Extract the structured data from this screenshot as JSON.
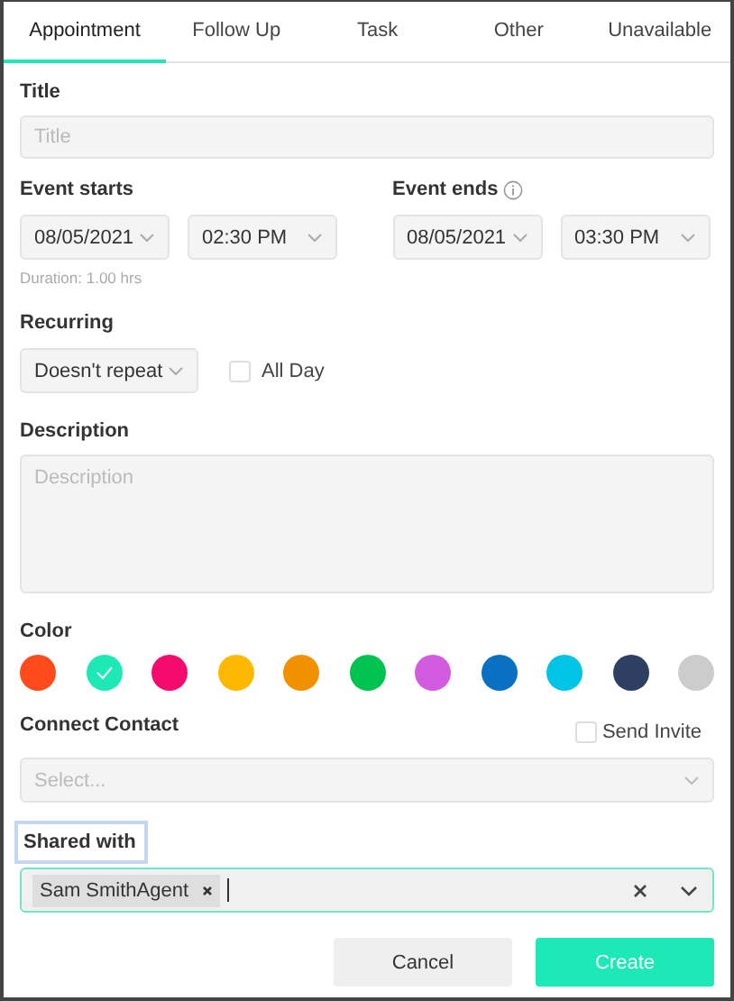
{
  "tabs": [
    {
      "label": "Appointment",
      "selected": true
    },
    {
      "label": "Follow Up",
      "selected": false
    },
    {
      "label": "Task",
      "selected": false
    },
    {
      "label": "Other",
      "selected": false
    },
    {
      "label": "Unavailable",
      "selected": false
    }
  ],
  "title": {
    "label": "Title",
    "placeholder": "Title"
  },
  "event_starts": {
    "label": "Event starts",
    "date": "08/05/2021",
    "time": "02:30 PM",
    "duration": "Duration: 1.00 hrs"
  },
  "event_ends": {
    "label": "Event ends",
    "date": "08/05/2021",
    "time": "03:30 PM"
  },
  "recurring": {
    "label": "Recurring",
    "value": "Doesn't repeat",
    "all_day": {
      "label": "All Day",
      "checked": false
    }
  },
  "description": {
    "label": "Description",
    "placeholder": "Description"
  },
  "color": {
    "label": "Color",
    "swatches": [
      {
        "color": "#ff4a1c",
        "selected": false
      },
      {
        "color": "#1de9b6",
        "selected": true
      },
      {
        "color": "#f50a6e",
        "selected": false
      },
      {
        "color": "#ffb800",
        "selected": false
      },
      {
        "color": "#f29100",
        "selected": false
      },
      {
        "color": "#00c250",
        "selected": false
      },
      {
        "color": "#d35bdf",
        "selected": false
      },
      {
        "color": "#0a70c2",
        "selected": false
      },
      {
        "color": "#00c4e6",
        "selected": false
      },
      {
        "color": "#2d3f63",
        "selected": false
      },
      {
        "color": "#cccccc",
        "selected": false
      }
    ]
  },
  "connect_contact": {
    "label": "Connect Contact",
    "placeholder": "Select...",
    "send_invite": {
      "label": "Send Invite",
      "checked": false
    }
  },
  "shared_with": {
    "label": "Shared with",
    "label_focused": true,
    "tags": [
      "Sam SmithAgent"
    ]
  },
  "buttons": {
    "cancel": "Cancel",
    "create": "Create"
  }
}
